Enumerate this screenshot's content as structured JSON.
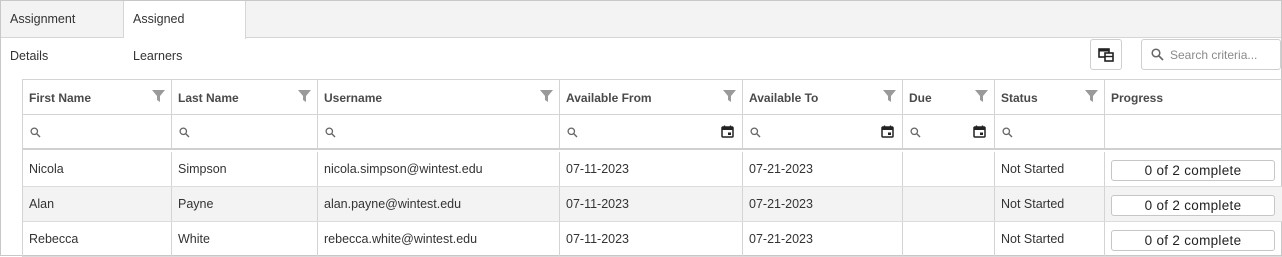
{
  "tabs": [
    {
      "label": "Assignment Details",
      "active": false
    },
    {
      "label": "Assigned Learners",
      "active": true
    }
  ],
  "toolbar": {
    "column_chooser_icon": "column-chooser-icon",
    "search_placeholder": "Search criteria...",
    "search_value": ""
  },
  "grid": {
    "columns": [
      {
        "label": "First Name",
        "filter": true,
        "filter_input": "text"
      },
      {
        "label": "Last Name",
        "filter": true,
        "filter_input": "text"
      },
      {
        "label": "Username",
        "filter": true,
        "filter_input": "text"
      },
      {
        "label": "Available From",
        "filter": true,
        "filter_input": "date"
      },
      {
        "label": "Available To",
        "filter": true,
        "filter_input": "date"
      },
      {
        "label": "Due",
        "filter": true,
        "filter_input": "date"
      },
      {
        "label": "Status",
        "filter": true,
        "filter_input": "text"
      },
      {
        "label": "Progress",
        "filter": false,
        "filter_input": "none"
      }
    ],
    "rows": [
      {
        "first_name": "Nicola",
        "last_name": "Simpson",
        "username": "nicola.simpson@wintest.edu",
        "available_from": "07-11-2023",
        "available_to": "07-21-2023",
        "due": "",
        "status": "Not Started",
        "progress": "0 of 2 complete"
      },
      {
        "first_name": "Alan",
        "last_name": "Payne",
        "username": "alan.payne@wintest.edu",
        "available_from": "07-11-2023",
        "available_to": "07-21-2023",
        "due": "",
        "status": "Not Started",
        "progress": "0 of 2 complete"
      },
      {
        "first_name": "Rebecca",
        "last_name": "White",
        "username": "rebecca.white@wintest.edu",
        "available_from": "07-11-2023",
        "available_to": "07-21-2023",
        "due": "",
        "status": "Not Started",
        "progress": "0 of 2 complete"
      }
    ]
  },
  "colors": {
    "header_text": "#4a4a4a",
    "icon_gray": "#9a9a9a",
    "alt_row": "#f3f3f3",
    "border": "#d4d4d4"
  }
}
